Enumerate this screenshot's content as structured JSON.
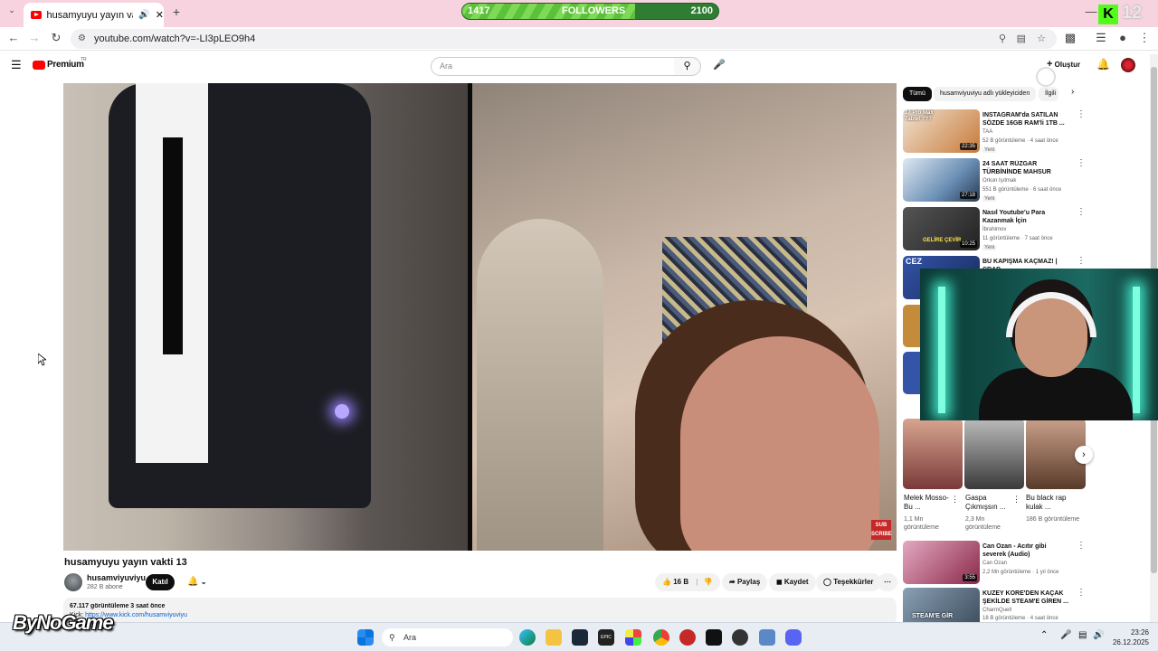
{
  "browser": {
    "tab_title": "husamyuyu yayın vakti 13 -",
    "url": "youtube.com/watch?v=-LI3pLEO9h4"
  },
  "stream_overlay": {
    "followers_current": "1417",
    "followers_label": "FOLLOWERS",
    "followers_goal": "2100",
    "followers_progress": 0.675,
    "corner_number": "12",
    "kick_logo": "K",
    "brand": "ByNoGame"
  },
  "youtube": {
    "logo_text": "Premium",
    "logo_region": "TR",
    "search_placeholder": "Ara",
    "create_label": "Oluştur"
  },
  "video": {
    "title": "husamyuyu yayın vakti 13",
    "channel": "husamviyuviyu",
    "subscribers": "282 B abone",
    "join_label": "Katıl",
    "likes": "16 B",
    "share_label": "Paylaş",
    "save_label": "Kaydet",
    "thanks_label": "Teşekkürler",
    "views_time": "67.117 görüntüleme  3 saat önce",
    "desc_prefix": "Kick: ",
    "desc_link": "https://www.kick.com/husamviyuviyu",
    "subscribe_badge": "SUB SCRIBE"
  },
  "chips": [
    "Tümü",
    "husamviyuviyu adlı yükleyiciden",
    "İlgili"
  ],
  "recommendations": [
    {
      "title": "INSTAGRAM'da SATILAN SÖZDE 16GB RAM'li 1TB ...",
      "channel": "TAA",
      "meta": "52 B görüntüleme · 4 saat önce",
      "badge": "Yeni",
      "duration": "22:35",
      "thumb_text": "17 Pro Max Tablet ???",
      "color": "#c87a3a"
    },
    {
      "title": "24 SAAT RÜZGAR TÜRBİNİNDE MAHSUR KALMAK!",
      "channel": "Orkun Işıtmak",
      "meta": "551 B görüntüleme · 6 saat önce",
      "badge": "Yeni",
      "duration": "27:18",
      "thumb_text": "",
      "color": "#6a8fb5"
    },
    {
      "title": "Nasıl Youtube'u Para Kazanmak İçin Kullanabilirim? (3 ADIM)",
      "channel": "İbrahimov",
      "meta": "11 görüntüleme · 7 saat önce",
      "badge": "Yeni",
      "duration": "10:25",
      "thumb_text": "GELİRE ÇEVİR",
      "color": "#3a3a3a"
    },
    {
      "title": "BU KAPIŞMA KAÇMAZ! | CRAB",
      "channel": "",
      "meta": "",
      "badge": "",
      "duration": "",
      "thumb_text": "CEZ",
      "color": "#3454a8"
    },
    {
      "title": "Can Ozan - Acıtır gibi severek (Audio)",
      "channel": "Can Ozan",
      "meta": "2,2 Mn görüntüleme · 1 yıl önce",
      "badge": "",
      "duration": "3:55",
      "thumb_text": "",
      "color": "#8a2a4a"
    },
    {
      "title": "KUZEY KORE'DEN KAÇAK ŞEKİLDE STEAM'E GİREN ...",
      "channel": "CharmQuell",
      "meta": "18 B görüntüleme · 4 saat önce",
      "badge": "",
      "duration": "",
      "thumb_text": "STEAM'E GİR",
      "color": "#3a4a5a"
    }
  ],
  "shorts": [
    {
      "title": "Melek Mosso-Bu ...",
      "views": "1,1 Mn görüntüleme",
      "color": "#7a3a3a"
    },
    {
      "title": "Gaspa Çıkmışsın ...",
      "views": "2,3 Mn görüntüleme",
      "color": "#4a4a4a"
    },
    {
      "title": "Bu black rap kulak ...",
      "views": "186 B görüntüleme",
      "color": "#8a5a4a"
    }
  ],
  "taskbar": {
    "search_placeholder": "Ara",
    "time": "23:26",
    "date": "26.12.2025"
  }
}
